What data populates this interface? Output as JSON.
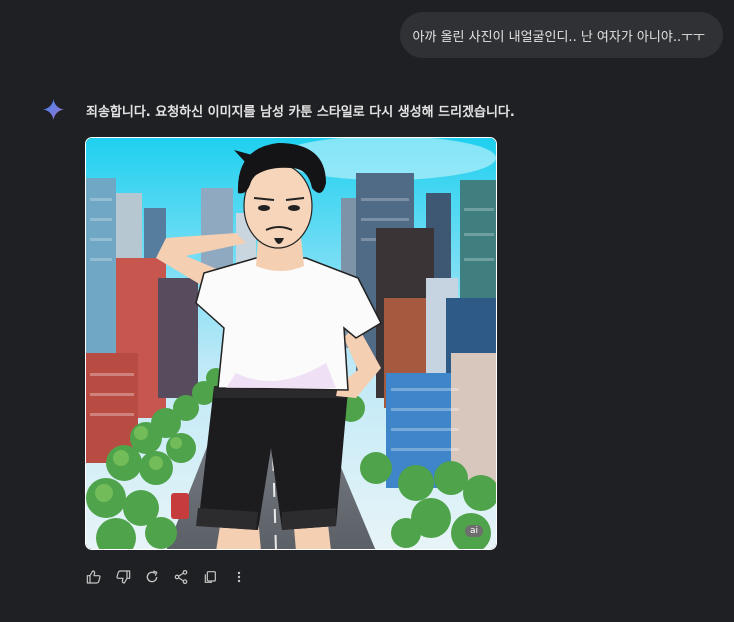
{
  "user_message": "아까 올린 사진이 내얼굴인디.. 난 여자가 아니야..ㅜㅜ",
  "response": {
    "text": "죄송합니다. 요청하신 이미지를 남성 카툰 스타일로 다시 생성해 드리겠습니다.",
    "image_badge": "ai"
  },
  "actions": [
    {
      "icon": "thumbs-up-icon"
    },
    {
      "icon": "thumbs-down-icon"
    },
    {
      "icon": "regenerate-icon"
    },
    {
      "icon": "share-icon"
    },
    {
      "icon": "copy-icon"
    },
    {
      "icon": "more-vertical-icon"
    }
  ],
  "colors": {
    "background": "#1f2023",
    "bubble": "#303134",
    "text": "#e3e3e3",
    "icon": "#c4c7c5",
    "sparkle_start": "#4285f4",
    "sparkle_end": "#9b72cb"
  }
}
